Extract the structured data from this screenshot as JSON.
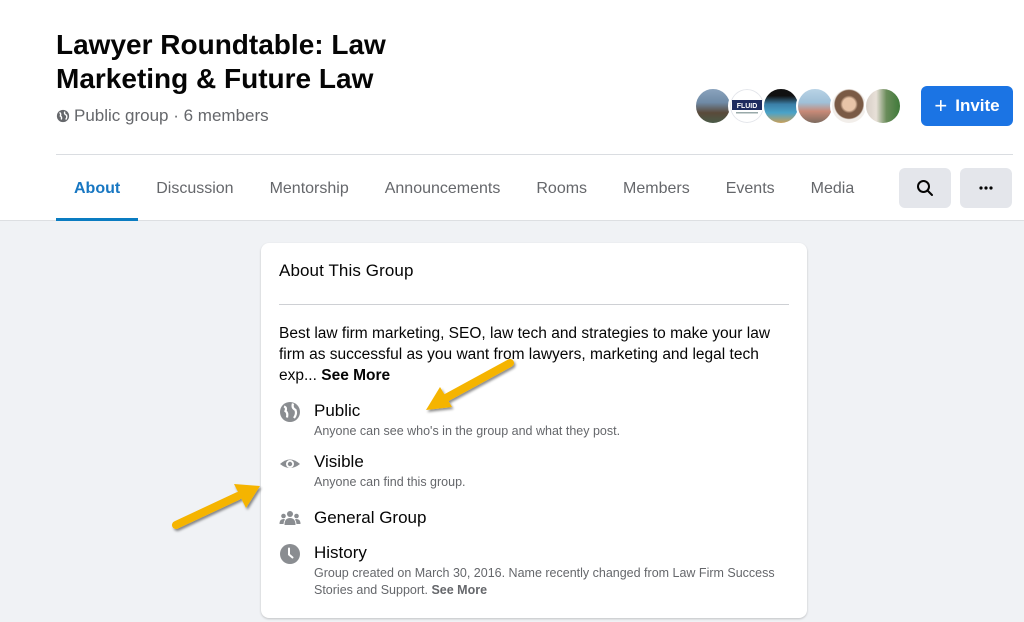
{
  "header": {
    "title": "Lawyer Roundtable: Law Marketing & Future Law",
    "meta": "Public group · 6 members",
    "meta_icon": "globe-icon",
    "invite_label": "Invite",
    "invite_icon": "plus-icon"
  },
  "members_preview": [
    {
      "name": "member-avatar-1",
      "colors": [
        "#6f8aa6",
        "#4a5b48"
      ]
    },
    {
      "name": "member-avatar-2",
      "colors": [
        "#ffffff",
        "#1e2b5e"
      ]
    },
    {
      "name": "member-avatar-3",
      "colors": [
        "#111111",
        "#4aa3c8"
      ]
    },
    {
      "name": "member-avatar-4",
      "colors": [
        "#9fc0d8",
        "#c88a78"
      ]
    },
    {
      "name": "member-avatar-5",
      "colors": [
        "#f2eeea",
        "#7a5a45"
      ]
    },
    {
      "name": "member-avatar-6",
      "colors": [
        "#3f7a3a",
        "#d8d0c8"
      ]
    }
  ],
  "tabs": [
    {
      "label": "About",
      "active": true
    },
    {
      "label": "Discussion",
      "active": false
    },
    {
      "label": "Mentorship",
      "active": false
    },
    {
      "label": "Announcements",
      "active": false
    },
    {
      "label": "Rooms",
      "active": false
    },
    {
      "label": "Members",
      "active": false
    },
    {
      "label": "Events",
      "active": false
    },
    {
      "label": "Media",
      "active": false
    }
  ],
  "toolbar": {
    "search_icon": "search-icon",
    "more_icon": "more-options-icon"
  },
  "about": {
    "title": "About This Group",
    "description": "Best law firm marketing, SEO, law tech and strategies to make your law firm as successful as you want from lawyers, marketing and legal tech exp...",
    "see_more": "See More",
    "items": [
      {
        "icon": "globe-icon",
        "title": "Public",
        "subtitle": "Anyone can see who's in the group and what they post."
      },
      {
        "icon": "eye-icon",
        "title": "Visible",
        "subtitle": "Anyone can find this group."
      },
      {
        "icon": "people-icon",
        "title": "General Group",
        "subtitle": ""
      },
      {
        "icon": "clock-icon",
        "title": "History",
        "subtitle": "Group created on March 30, 2016. Name recently changed from Law Firm Success Stories and Support.",
        "see_more": "See More"
      }
    ]
  },
  "annotations": {
    "arrow_color": "#f5b400"
  },
  "colors": {
    "accent": "#1b74e4",
    "active_tab": "#0a7cc1",
    "page_bg": "#f0f2f5",
    "secondary_text": "#65676b",
    "icon_gray": "#8a8d91"
  }
}
